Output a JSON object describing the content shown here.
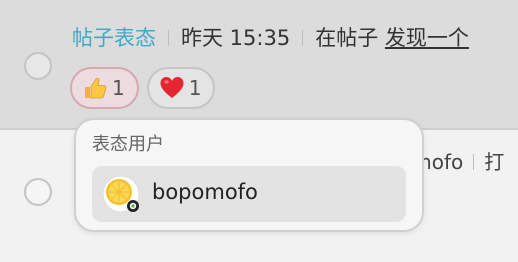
{
  "notification": {
    "type_label": "帖子表态",
    "time": "昨天 15:35",
    "action": "在帖子",
    "post_title": "发现一个"
  },
  "reactions": [
    {
      "emoji": "thumbs-up-icon",
      "count": "1",
      "active": true
    },
    {
      "emoji": "heart-icon",
      "count": "1",
      "active": false
    }
  ],
  "popover": {
    "title": "表态用户",
    "users": [
      {
        "name": "bopomofo",
        "avatar": "lemon-avatar-icon"
      }
    ]
  },
  "next_notification": {
    "user_partial": "omofo",
    "action_partial": "打"
  },
  "colors": {
    "accent": "#43a9c6",
    "active_chip_border": "#d7a8b0"
  }
}
